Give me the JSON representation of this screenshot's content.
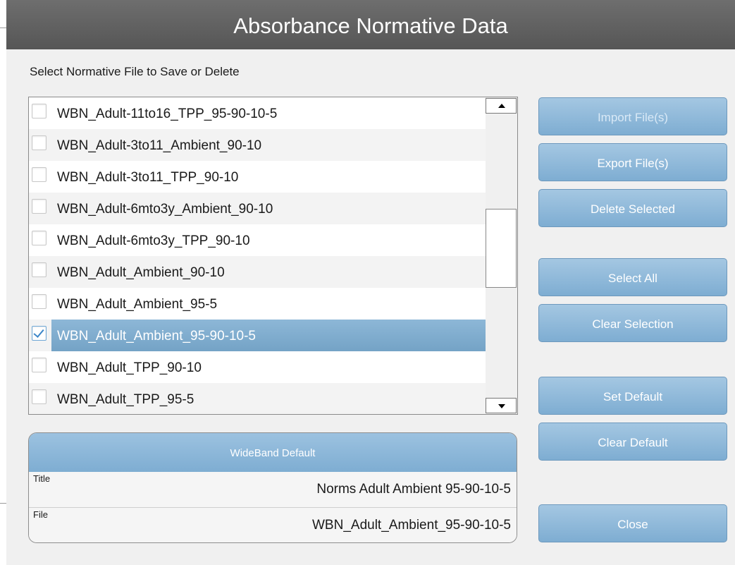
{
  "window": {
    "title": "Absorbance Normative Data"
  },
  "instruction": "Select Normative File to Save or Delete",
  "files": [
    {
      "label": "WBN_Adult-11to16_TPP_95-90-10-5",
      "checked": false,
      "selected": false
    },
    {
      "label": "WBN_Adult-3to11_Ambient_90-10",
      "checked": false,
      "selected": false
    },
    {
      "label": "WBN_Adult-3to11_TPP_90-10",
      "checked": false,
      "selected": false
    },
    {
      "label": "WBN_Adult-6mto3y_Ambient_90-10",
      "checked": false,
      "selected": false
    },
    {
      "label": "WBN_Adult-6mto3y_TPP_90-10",
      "checked": false,
      "selected": false
    },
    {
      "label": "WBN_Adult_Ambient_90-10",
      "checked": false,
      "selected": false
    },
    {
      "label": "WBN_Adult_Ambient_95-5",
      "checked": false,
      "selected": false
    },
    {
      "label": "WBN_Adult_Ambient_95-90-10-5",
      "checked": true,
      "selected": true
    },
    {
      "label": "WBN_Adult_TPP_90-10",
      "checked": false,
      "selected": false
    },
    {
      "label": "WBN_Adult_TPP_95-5",
      "checked": false,
      "selected": false
    }
  ],
  "buttons": {
    "import": "Import File(s)",
    "export": "Export File(s)",
    "delete": "Delete Selected",
    "select_all": "Select All",
    "clear_selection": "Clear Selection",
    "set_default": "Set Default",
    "clear_default": "Clear Default",
    "close": "Close"
  },
  "default_panel": {
    "header": "WideBand Default",
    "title_label": "Title",
    "title_value": "Norms Adult Ambient 95-90-10-5",
    "file_label": "File",
    "file_value": "WBN_Adult_Ambient_95-90-10-5"
  },
  "icons": {
    "scroll_up": "triangle-up-icon",
    "scroll_down": "triangle-down-icon",
    "checkbox": "checkmark-icon"
  },
  "colors": {
    "titlebar": "#5f5f5f",
    "button": "#8fb8d9",
    "selection": "#7fabcc"
  }
}
